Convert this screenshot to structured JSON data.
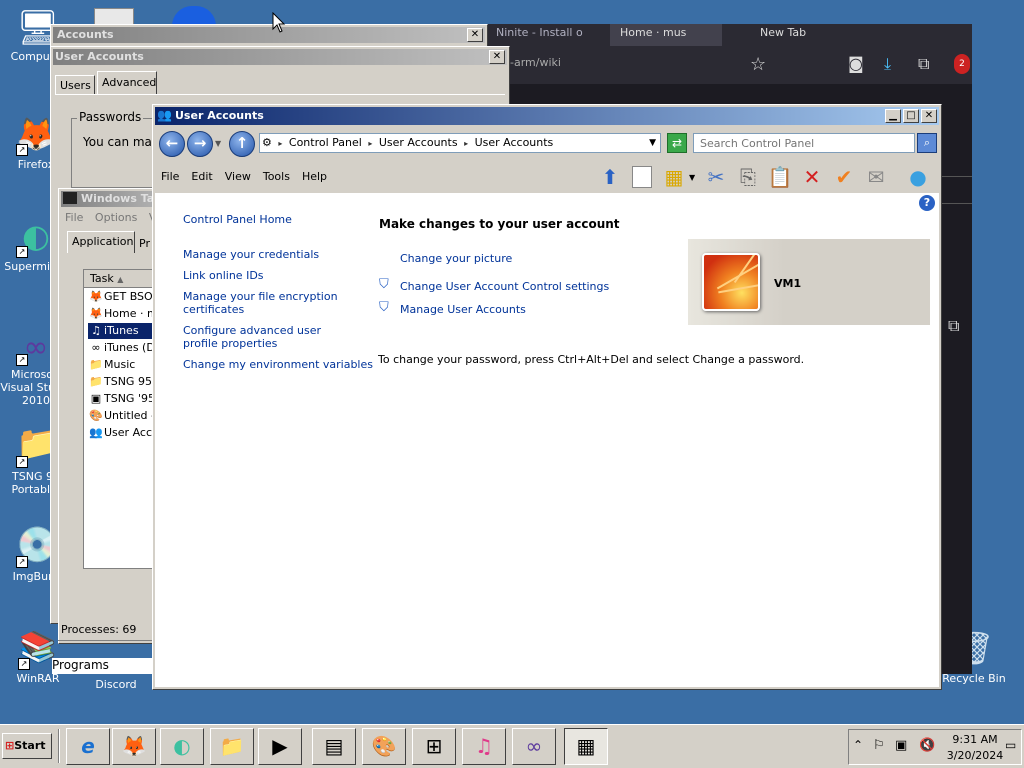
{
  "desktop": {
    "icons": [
      {
        "label": "Computer",
        "glyph": "🖥",
        "name": "computer-icon"
      },
      {
        "label": "Firefox",
        "glyph": "🦊",
        "name": "firefox-icon"
      },
      {
        "label": "Supermium",
        "glyph": "◐",
        "name": "supermium-icon"
      },
      {
        "label": "Microsoft Visual Studio 2010",
        "glyph": "∞",
        "name": "visual-studio-icon"
      },
      {
        "label": "TSNG 95 Portabl...",
        "glyph": "📁",
        "name": "tsng-folder-icon"
      },
      {
        "label": "ImgBurn",
        "glyph": "💿",
        "name": "imgburn-icon"
      },
      {
        "label": "WinRAR",
        "glyph": "📚",
        "name": "winrar-icon"
      },
      {
        "label": "Discord",
        "glyph": "◉",
        "name": "discord-icon"
      },
      {
        "label": "Recycle Bin",
        "glyph": "🗑",
        "name": "recycle-bin-icon"
      }
    ]
  },
  "browser": {
    "tabs": [
      "Ninite - Install o",
      "Home · mus",
      "New Tab"
    ],
    "address_fragment": "-arm/wiki",
    "badge": "2"
  },
  "accounts_back": {
    "title": "Accounts"
  },
  "user_accounts_old": {
    "title": "User Accounts",
    "tabs": [
      "Users",
      "Advanced"
    ],
    "group_title": "Passwords",
    "text": "You can man"
  },
  "task_manager": {
    "title": "Windows Task Manager",
    "menu": [
      "File",
      "Options",
      "Vi"
    ],
    "tabs": [
      "Applications",
      "Pr"
    ],
    "column_header": "Task",
    "tasks": [
      {
        "label": "GET BSOD",
        "glyph": "🦊"
      },
      {
        "label": "Home · m",
        "glyph": "🦊"
      },
      {
        "label": "iTunes",
        "glyph": "♫"
      },
      {
        "label": "iTunes (D",
        "glyph": "∞"
      },
      {
        "label": "Music",
        "glyph": "📁"
      },
      {
        "label": "TSNG 95",
        "glyph": "📁"
      },
      {
        "label": "TSNG '95",
        "glyph": "▣"
      },
      {
        "label": "Untitled -",
        "glyph": "🎨"
      },
      {
        "label": "User Acco",
        "glyph": "👥"
      }
    ],
    "processes": "Processes: 69",
    "programs_label": "Programs"
  },
  "main_window": {
    "title": "User Accounts",
    "breadcrumb": [
      "Control Panel",
      "User Accounts",
      "User Accounts"
    ],
    "search_placeholder": "Search Control Panel",
    "menu": [
      "File",
      "Edit",
      "View",
      "Tools",
      "Help"
    ],
    "sidebar_links": [
      "Control Panel Home",
      "Manage your credentials",
      "Link online IDs",
      "Manage your file encryption certificates",
      "Configure advanced user profile properties",
      "Change my environment variables"
    ],
    "heading": "Make changes to your user account",
    "tasks": [
      "Change your picture",
      "Change User Account Control settings",
      "Manage User Accounts"
    ],
    "user_name": "VM1",
    "password_note": "To change your password, press Ctrl+Alt+Del and select Change a password."
  },
  "taskbar": {
    "start": "Start",
    "buttons": [
      {
        "glyph": "e",
        "name": "taskbar-ie-button"
      },
      {
        "glyph": "🦊",
        "name": "taskbar-firefox-button"
      },
      {
        "glyph": "◐",
        "name": "taskbar-supermium-button"
      },
      {
        "glyph": "📁",
        "name": "taskbar-explorer-button"
      },
      {
        "glyph": "▶",
        "name": "taskbar-media-button"
      },
      {
        "glyph": "▤",
        "name": "taskbar-taskmanager-button"
      },
      {
        "glyph": "🎨",
        "name": "taskbar-paint-button"
      },
      {
        "glyph": "⊞",
        "name": "taskbar-windows-button"
      },
      {
        "glyph": "♫",
        "name": "taskbar-itunes-button"
      },
      {
        "glyph": "∞",
        "name": "taskbar-vs-button"
      },
      {
        "glyph": "▦",
        "name": "taskbar-controlpanel-button"
      }
    ],
    "time": "9:31 AM",
    "date": "3/20/2024"
  }
}
